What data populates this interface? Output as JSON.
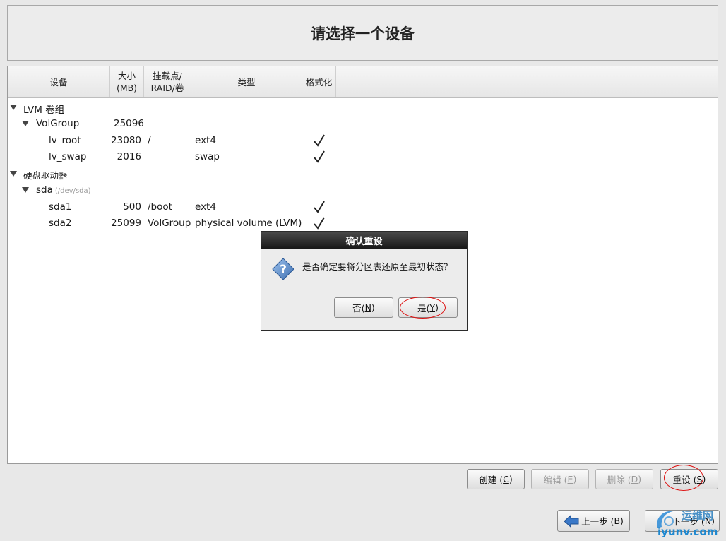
{
  "header": {
    "title": "请选择一个设备"
  },
  "table": {
    "columns": {
      "device": "设备",
      "size": "大小\n(MB)",
      "mount": "挂载点/\nRAID/卷",
      "type": "类型",
      "format": "格式化"
    },
    "rows": [
      {
        "device": "LVM 卷组",
        "size": "",
        "mount": "",
        "type": "",
        "format": false,
        "level": 0,
        "expander": true
      },
      {
        "device": "VolGroup",
        "size": "25096",
        "mount": "",
        "type": "",
        "format": false,
        "level": 1,
        "expander": true
      },
      {
        "device": "lv_root",
        "size": "23080",
        "mount": "/",
        "type": "ext4",
        "format": true,
        "level": 2,
        "expander": false
      },
      {
        "device": "lv_swap",
        "size": "2016",
        "mount": "",
        "type": "swap",
        "format": true,
        "level": 2,
        "expander": false
      },
      {
        "device": "硬盘驱动器",
        "size": "",
        "mount": "",
        "type": "",
        "format": false,
        "level": 0,
        "expander": true
      },
      {
        "device": "sda",
        "path": "(/dev/sda)",
        "size": "",
        "mount": "",
        "type": "",
        "format": false,
        "level": 1,
        "expander": true
      },
      {
        "device": "sda1",
        "size": "500",
        "mount": "/boot",
        "type": "ext4",
        "format": true,
        "level": 2,
        "expander": false
      },
      {
        "device": "sda2",
        "size": "25099",
        "mount": "VolGroup",
        "type": "physical volume (LVM)",
        "format": true,
        "level": 2,
        "expander": false
      }
    ]
  },
  "dialog": {
    "title": "确认重设",
    "icon": "question-icon",
    "message": "是否确定要将分区表还原至最初状态？",
    "no_label": "否(",
    "no_key": "N",
    "yes_label": "是(",
    "yes_key": "Y"
  },
  "actions": {
    "create_label": "创建 (",
    "create_key": "C",
    "edit_label": "编辑 (",
    "edit_key": "E",
    "delete_label": "删除 (",
    "delete_key": "D",
    "reset_label": "重设 (",
    "reset_key": "S"
  },
  "nav": {
    "back_label": "上一步 (",
    "back_key": "B",
    "next_label": "下一步 (",
    "next_key": "N"
  },
  "watermark": {
    "top": "运维网",
    "bottom": "iyunv.com"
  },
  "colors": {
    "annotation_red": "#dd1111",
    "dialog_title_bg": "#1e1e1e",
    "question_blue": "#3f6fb0"
  }
}
